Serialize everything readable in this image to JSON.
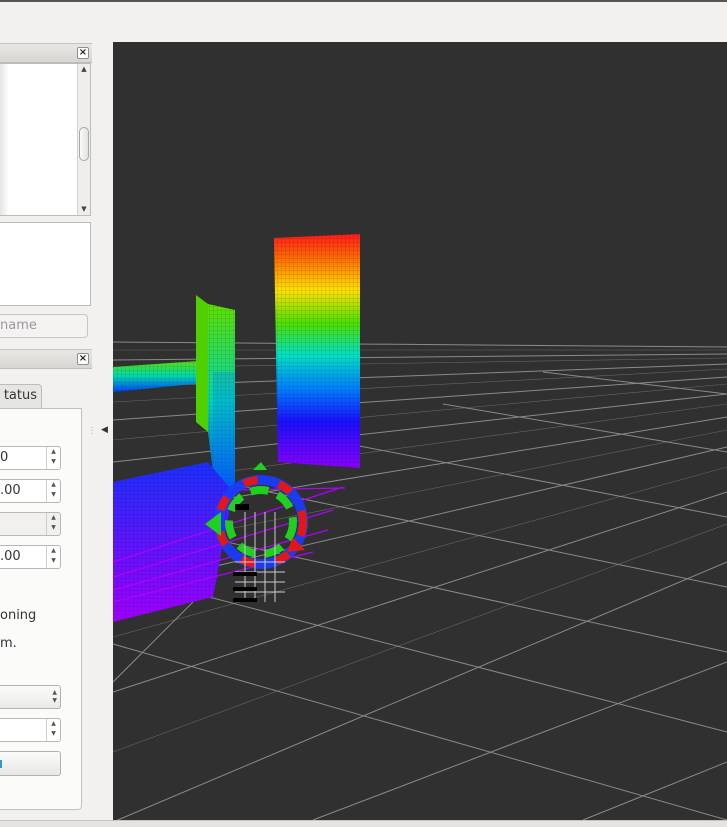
{
  "left_panel": {
    "close_glyph": "×",
    "name_placeholder": "name",
    "tab_status_label": "tatus",
    "spin_values": [
      "0",
      ".00",
      "",
      ".00"
    ],
    "text_lines": [
      "oning",
      "m."
    ]
  },
  "icons": {
    "close": "close-icon",
    "scroll_up": "scroll-up-arrow-icon",
    "scroll_down": "scroll-down-arrow-icon",
    "splitter_collapse": "collapse-left-triangle-icon"
  },
  "colors": {
    "viewport_bg": "#303030",
    "grid_line": "#8a8a8a",
    "window_bg": "#f2f1f0"
  }
}
